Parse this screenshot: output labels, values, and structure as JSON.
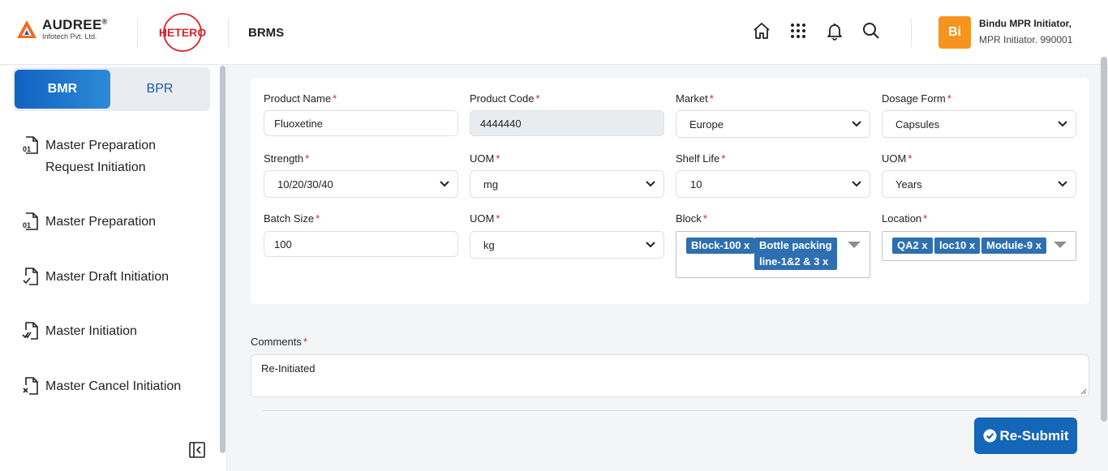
{
  "header": {
    "brand_name": "AUDREE",
    "brand_reg": "®",
    "brand_sub": "Infotech Pvt. Ltd.",
    "partner_logo_text": "HETERO",
    "app_name": "BRMS",
    "icons": [
      "home-icon",
      "apps-grid-icon",
      "bell-icon",
      "search-icon"
    ],
    "user": {
      "initials": "Bi",
      "name": "Bindu MPR Initiator,",
      "role": "MPR Initiator. 990001",
      "avatar_color": "#f7941d"
    }
  },
  "sidebar": {
    "tabs": [
      {
        "label": "BMR",
        "active": true
      },
      {
        "label": "BPR",
        "active": false
      }
    ],
    "items": [
      {
        "label_line1": "Master Preparation",
        "label_line2": "Request Initiation",
        "icon": "file-01-icon"
      },
      {
        "label": "Master Preparation",
        "icon": "file-01-icon"
      },
      {
        "label": "Master Draft Initiation",
        "icon": "file-check-icon"
      },
      {
        "label": "Master Initiation",
        "icon": "file-double-check-icon"
      },
      {
        "label": "Master Cancel Initiation",
        "icon": "file-cancel-icon"
      }
    ]
  },
  "form": {
    "product_name": {
      "label": "Product Name",
      "value": "Fluoxetine"
    },
    "product_code": {
      "label": "Product Code",
      "value": "4444440"
    },
    "market": {
      "label": "Market",
      "value": "Europe"
    },
    "dosage_form": {
      "label": "Dosage Form",
      "value": "Capsules"
    },
    "strength": {
      "label": "Strength",
      "value": "10/20/30/40"
    },
    "strength_uom": {
      "label": "UOM",
      "value": "mg"
    },
    "shelf_life": {
      "label": "Shelf Life",
      "value": "10"
    },
    "shelf_uom": {
      "label": "UOM",
      "value": "Years"
    },
    "batch_size": {
      "label": "Batch Size",
      "value": "100"
    },
    "batch_uom": {
      "label": "UOM",
      "value": "kg"
    },
    "block": {
      "label": "Block",
      "chips": [
        "Block-100",
        "Bottle packing",
        "line-1&2 & 3"
      ]
    },
    "location": {
      "label": "Location",
      "chips": [
        "QA2",
        "loc10",
        "Module-9"
      ]
    },
    "required_mark": "*",
    "chip_remove": "x"
  },
  "comments": {
    "label": "Comments",
    "value": "Re-Initiated"
  },
  "actions": {
    "resubmit_label": "Re-Submit",
    "button_color": "#1366b8"
  }
}
